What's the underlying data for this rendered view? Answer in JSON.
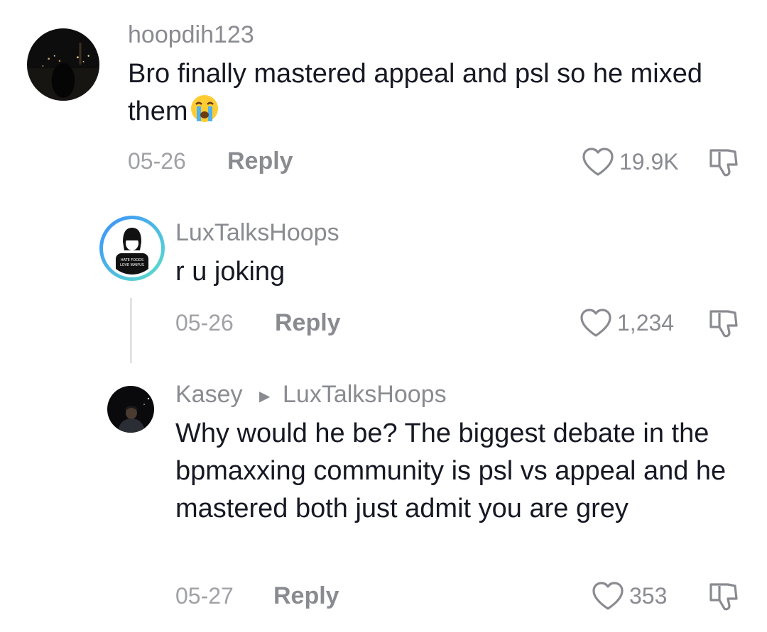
{
  "comments": [
    {
      "username": "hoopdih123",
      "text": "Bro finally mastered appeal and psl so he mixed them",
      "emoji": "loudly-crying-face",
      "date": "05-26",
      "reply_label": "Reply",
      "likes": "19.9K"
    },
    {
      "username": "LuxTalksHoops",
      "avatar_caption": "HATE FOODS LOVE WAIFUS",
      "text": "r u joking",
      "date": "05-26",
      "reply_label": "Reply",
      "likes": "1,234"
    },
    {
      "username": "Kasey",
      "reply_to": "LuxTalksHoops",
      "text": "Why would he be? The biggest debate in the bpmaxxing community is psl vs appeal and he mastered both just admit you are grey",
      "date": "05-27",
      "reply_label": "Reply",
      "likes": "353"
    }
  ],
  "icons": {
    "like": "heart-outline-icon",
    "dislike": "thumbs-down-icon",
    "reply_arrow": "triangle-right-icon"
  },
  "colors": {
    "text_primary": "#161823",
    "text_secondary": "#8a8b91",
    "story_ring_start": "#3b8fff",
    "story_ring_end": "#5ee0c8"
  }
}
